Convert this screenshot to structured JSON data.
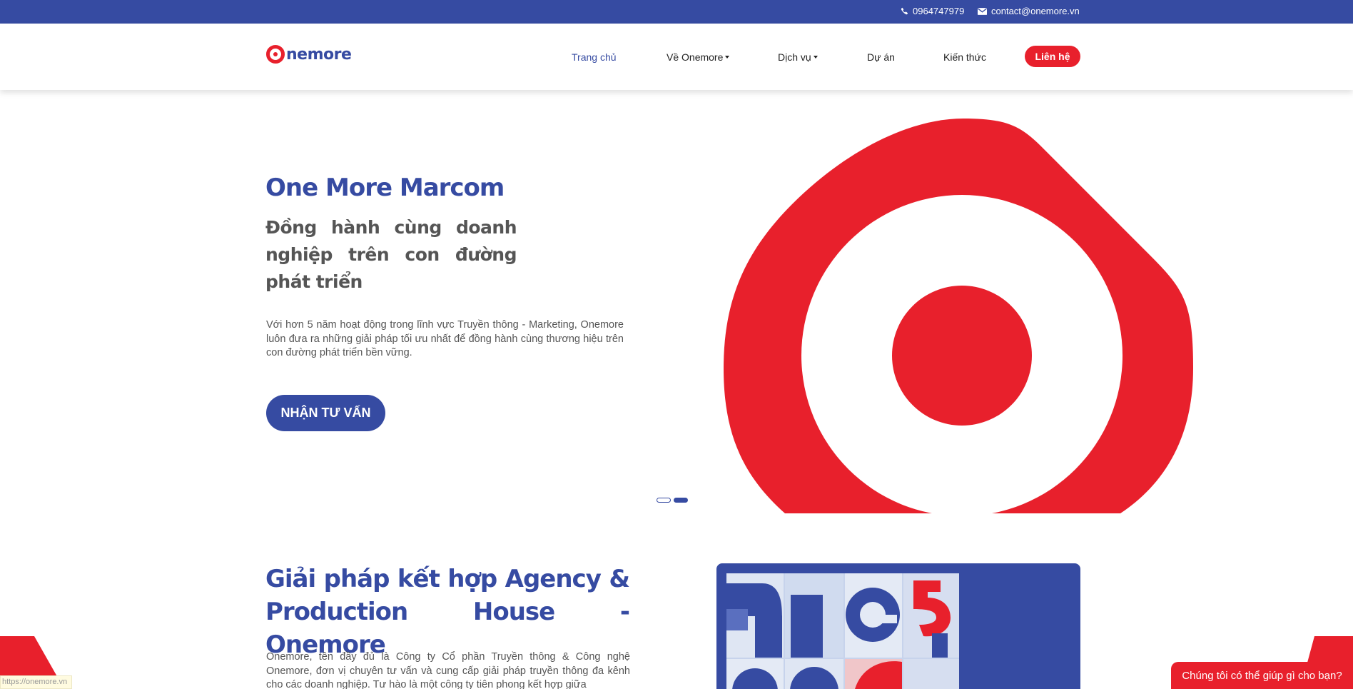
{
  "topbar": {
    "phone": "0964747979",
    "email": "contact@onemore.vn",
    "background": "#364ba2"
  },
  "header": {
    "logo_text": "nemore",
    "nav": [
      {
        "label": "Trang chủ",
        "active": true
      },
      {
        "label": "Về Onemore",
        "dropdown": true
      },
      {
        "label": "Dịch vụ",
        "dropdown": true
      },
      {
        "label": "Dự án"
      },
      {
        "label": "Kiến thức"
      }
    ],
    "contact_button": "Liên hệ"
  },
  "hero": {
    "title": "One More Marcom",
    "subtitle": "Đồng hành cùng doanh nghiệp trên con đường phát triển",
    "description": "Với hơn 5 năm hoạt động trong lĩnh vực Truyền thông - Marketing, Onemore luôn đưa ra những giải pháp tối ưu nhất để đồng hành cùng thương hiệu trên con đường phát triển bền vững.",
    "cta": "NHẬN TƯ VẤN",
    "graphic_icon": "onemore-o-logo-icon",
    "slides": 2,
    "active_slide": 2
  },
  "section": {
    "title": "Giải pháp kết hợp Agency & Production House - Onemore",
    "description": "Onemore, tên đầy đủ là Công ty Cổ phần Truyền thông & Công nghệ Onemore, đơn vị chuyên tư vấn và cung cấp giải pháp truyền thông đa kênh cho các doanh nghiệp. Tư hào là một công ty tiên phong kết hợp giữa"
  },
  "chat": {
    "label": "Chúng tôi có thể giúp gì cho bạn?"
  },
  "status_bar": {
    "url": "https://onemore.vn"
  },
  "colors": {
    "brand_blue": "#364ba2",
    "brand_red": "#e8202c"
  }
}
